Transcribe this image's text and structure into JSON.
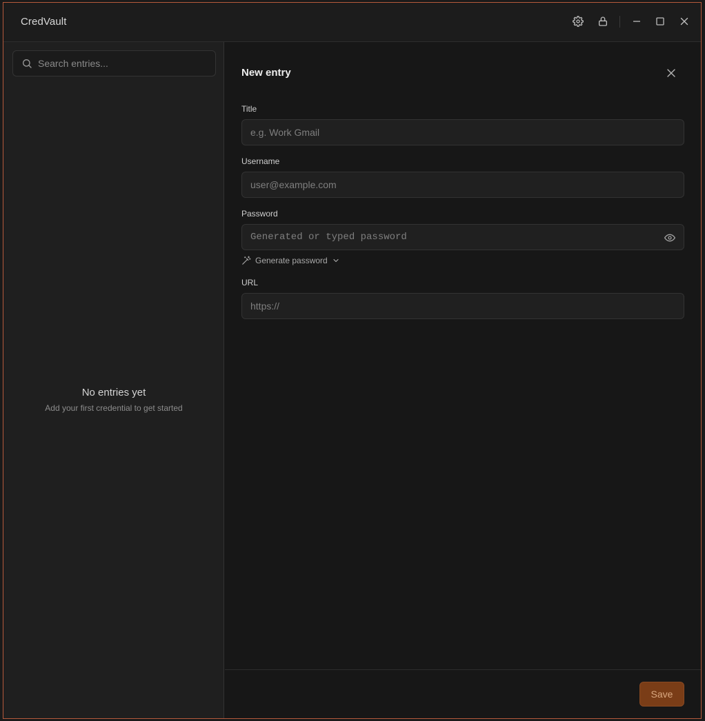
{
  "app": {
    "title": "CredVault"
  },
  "sidebar": {
    "search_placeholder": "Search entries...",
    "empty_title": "No entries yet",
    "empty_subtitle": "Add your first credential to get started"
  },
  "panel": {
    "title": "New entry",
    "fields": {
      "title": {
        "label": "Title",
        "placeholder": "e.g. Work Gmail",
        "value": ""
      },
      "username": {
        "label": "Username",
        "placeholder": "user@example.com",
        "value": ""
      },
      "password": {
        "label": "Password",
        "placeholder": "Generated or typed password",
        "value": ""
      },
      "url": {
        "label": "URL",
        "placeholder": "https://",
        "value": ""
      }
    },
    "generate_label": "Generate password",
    "save_label": "Save"
  },
  "icons": {
    "settings": "gear-icon",
    "lock": "lock-icon",
    "minimize": "minimize-icon",
    "maximize": "maximize-icon",
    "close": "close-icon",
    "search": "search-icon",
    "eye": "eye-icon",
    "wand": "wand-icon",
    "chevron": "chevron-down-icon"
  },
  "colors": {
    "accent": "#7a3d17",
    "border_accent": "#b65a3c"
  }
}
